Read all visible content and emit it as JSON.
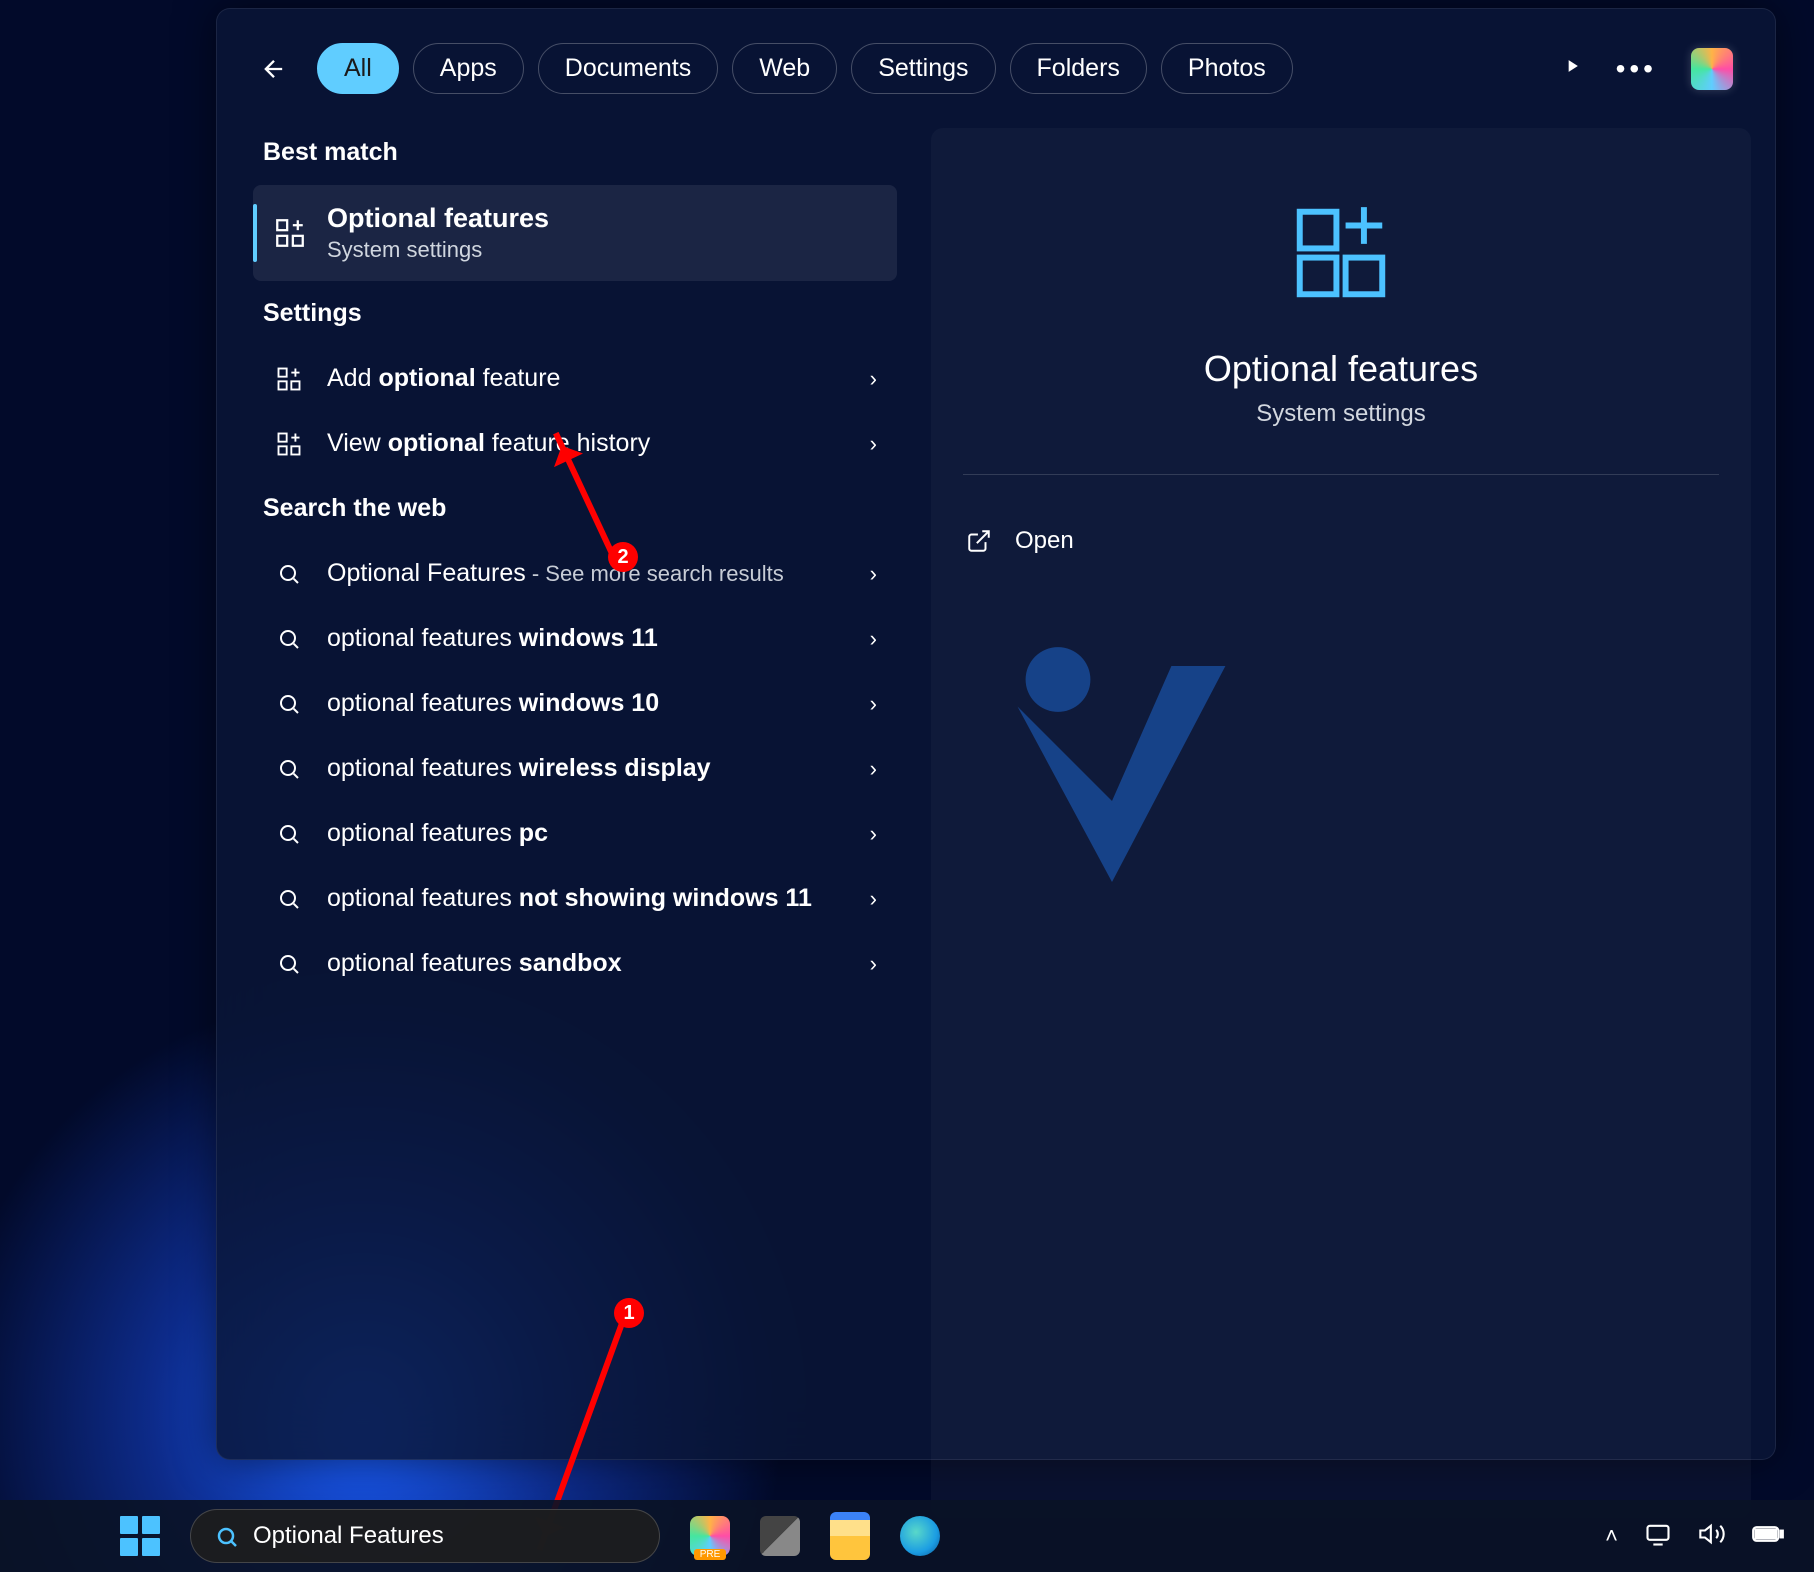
{
  "tabs": {
    "all": "All",
    "apps": "Apps",
    "documents": "Documents",
    "web": "Web",
    "settings": "Settings",
    "folders": "Folders",
    "photos": "Photos"
  },
  "sections": {
    "best_match": "Best match",
    "settings": "Settings",
    "search_web": "Search the web"
  },
  "best_match": {
    "title": "Optional features",
    "subtitle": "System settings"
  },
  "settings_results": [
    {
      "pre": "Add ",
      "bold": "optional",
      "post": " feature"
    },
    {
      "pre": "View ",
      "bold": "optional",
      "post": " feature history"
    }
  ],
  "web_results": [
    {
      "pre": "Optional Features",
      "sub": " - See more search results"
    },
    {
      "pre": "optional features ",
      "bold": "windows 11"
    },
    {
      "pre": "optional features ",
      "bold": "windows 10"
    },
    {
      "pre": "optional features ",
      "bold": "wireless display"
    },
    {
      "pre": "optional features ",
      "bold": "pc"
    },
    {
      "pre": "optional features ",
      "bold": "not showing windows 11"
    },
    {
      "pre": "optional features ",
      "bold": "sandbox"
    }
  ],
  "preview": {
    "title": "Optional features",
    "subtitle": "System settings",
    "open": "Open"
  },
  "taskbar": {
    "search_value": "Optional Features"
  },
  "annotations": {
    "badge1": "1",
    "badge2": "2"
  }
}
